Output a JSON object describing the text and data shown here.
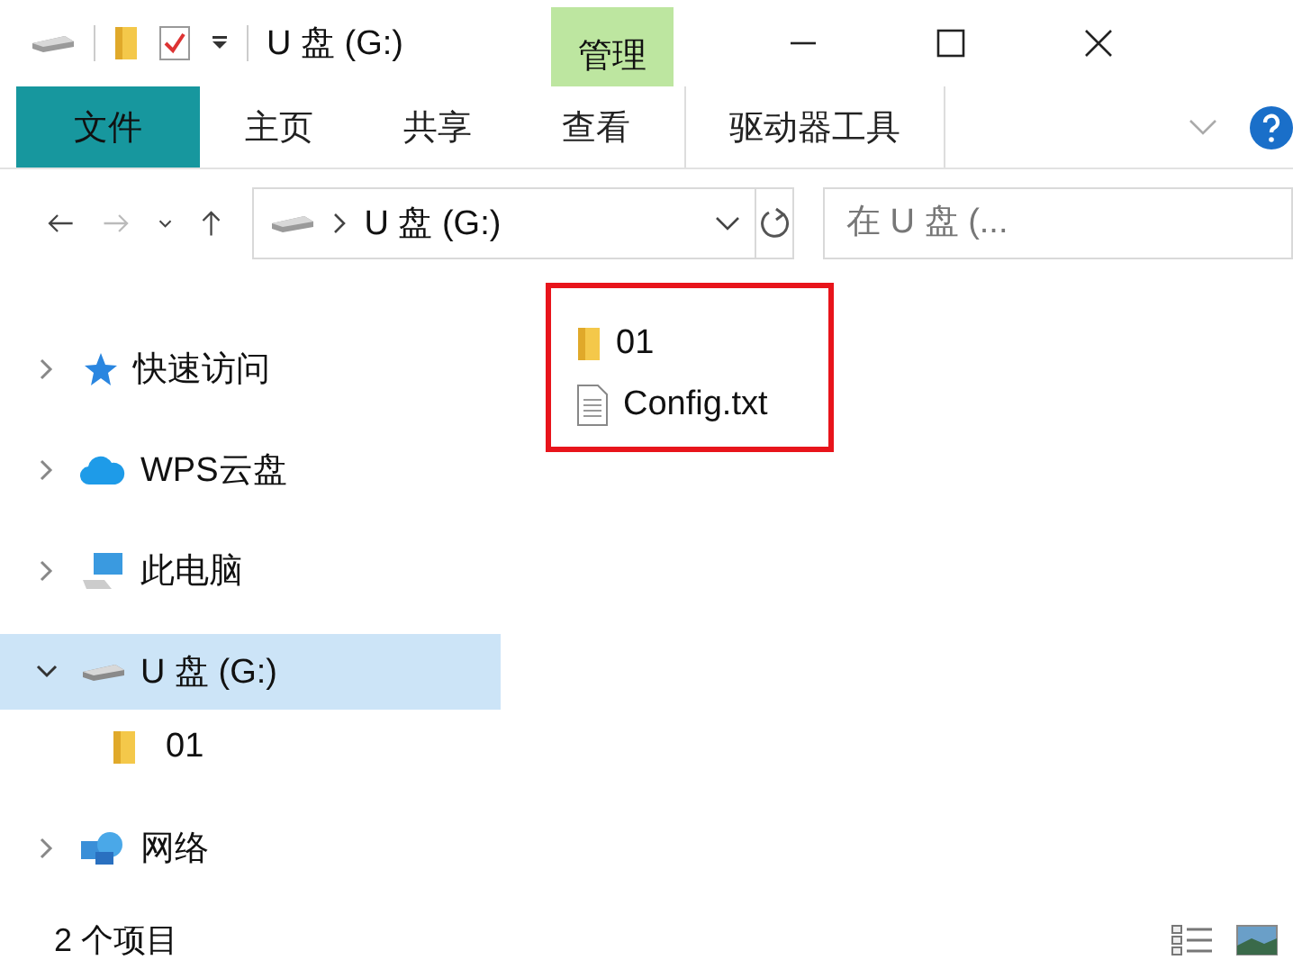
{
  "title_bar": {
    "title": "U 盘 (G:)",
    "context_tab": "管理"
  },
  "ribbon": {
    "tabs": [
      {
        "label": "文件",
        "kind": "file"
      },
      {
        "label": "主页",
        "kind": "tab"
      },
      {
        "label": "共享",
        "kind": "tab"
      },
      {
        "label": "查看",
        "kind": "tab"
      },
      {
        "label": "驱动器工具",
        "kind": "context"
      }
    ]
  },
  "address_bar": {
    "path": "U 盘 (G:)",
    "search_placeholder": "在 U 盘 (..."
  },
  "nav_pane": {
    "items": [
      {
        "label": "快速访问",
        "kind": "star",
        "expanded": false,
        "selected": false
      },
      {
        "label": "WPS云盘",
        "kind": "cloud",
        "expanded": false,
        "selected": false
      },
      {
        "label": "此电脑",
        "kind": "pc",
        "expanded": false,
        "selected": false
      },
      {
        "label": "U 盘 (G:)",
        "kind": "drive",
        "expanded": true,
        "selected": true,
        "children": [
          {
            "label": "01",
            "kind": "folder",
            "selected": false
          }
        ]
      },
      {
        "label": "网络",
        "kind": "network",
        "expanded": false,
        "selected": false
      }
    ]
  },
  "files": [
    {
      "name": "01",
      "kind": "folder"
    },
    {
      "name": "Config.txt",
      "kind": "text"
    }
  ],
  "status_bar": {
    "count": "2 个项目"
  }
}
